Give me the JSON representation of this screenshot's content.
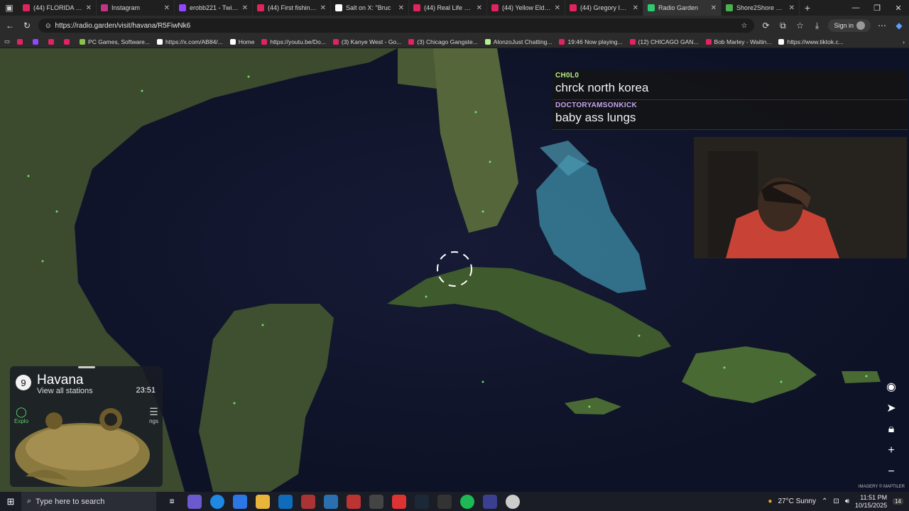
{
  "browser": {
    "tabs": [
      {
        "label": "(44) FLORIDA to BA",
        "color": "#e0245e"
      },
      {
        "label": "Instagram",
        "color": "#c13584"
      },
      {
        "label": "erobb221 - Twitch",
        "color": "#9146ff"
      },
      {
        "label": "(44) First fishing trip",
        "color": "#e0245e"
      },
      {
        "label": "Salt on X: \"Bruc",
        "color": "#ffffff"
      },
      {
        "label": "(44) Real Life Pilots",
        "color": "#e0245e"
      },
      {
        "label": "(44) Yellow Elder Pr",
        "color": "#e0245e"
      },
      {
        "label": "(44) Gregory Isaacs",
        "color": "#e0245e"
      },
      {
        "label": "Radio Garden",
        "color": "#2ecc71"
      },
      {
        "label": "Shore2Shore Bahan",
        "color": "#4caf50"
      }
    ],
    "url": "https://radio.garden/visit/havana/R5FiwNk6",
    "signin_label": "Sign in",
    "bookmarks": [
      {
        "label": "",
        "color": "#e0245e"
      },
      {
        "label": "",
        "color": "#9146ff"
      },
      {
        "label": "",
        "color": "#e0245e"
      },
      {
        "label": "",
        "color": "#e0245e"
      },
      {
        "label": "PC Games, Software...",
        "color": "#8bc34a"
      },
      {
        "label": "https://x.com/AB84/...",
        "color": "#ffffff"
      },
      {
        "label": "Home",
        "color": "#ffffff"
      },
      {
        "label": "https://youtu.be/Do...",
        "color": "#e0245e"
      },
      {
        "label": "(3) Kanye West - Go...",
        "color": "#e0245e"
      },
      {
        "label": "(3) Chicago Gangste...",
        "color": "#e0245e"
      },
      {
        "label": "AlonzoJust Chatting...",
        "color": "#b8f08a"
      },
      {
        "label": "19:46 Now playing...",
        "color": "#e0245e"
      },
      {
        "label": "(12) CHICAGO GAN...",
        "color": "#e0245e"
      },
      {
        "label": "Bob Marley - Waitin...",
        "color": "#e0245e"
      },
      {
        "label": "https://www.tiktok.c...",
        "color": "#ffffff"
      }
    ]
  },
  "chat": [
    {
      "user": "CH0L0",
      "text": "chrck north korea"
    },
    {
      "user": "DOCTORYAMSONKICK",
      "text": "baby ass lungs"
    }
  ],
  "station": {
    "count": "9",
    "city": "Havana",
    "link": "View all stations",
    "time": "23:51",
    "tab_explore": "Explo",
    "tab_settings": "ngs"
  },
  "map": {
    "credit": "IMAGERY © MAPTILER"
  },
  "taskbar": {
    "search_placeholder": "Type here to search",
    "weather": "27°C  Sunny",
    "time": "11:51 PM",
    "date": "10/15/2025",
    "notif_count": "14"
  },
  "icons": {
    "start": "windows-start-icon",
    "search": "search-icon",
    "back": "back-arrow-icon",
    "reload": "reload-icon"
  }
}
